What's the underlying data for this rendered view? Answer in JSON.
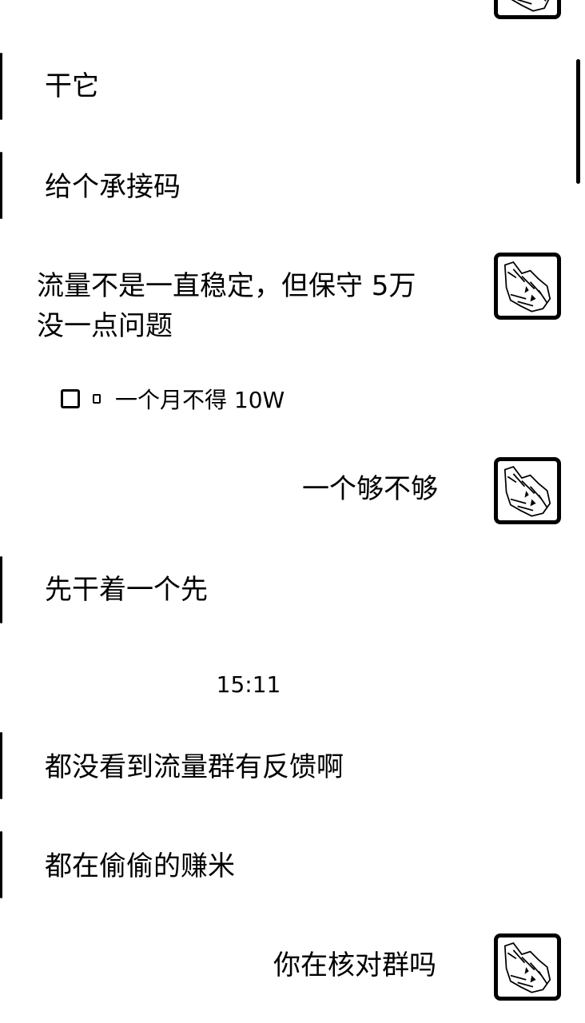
{
  "messages": [
    {
      "side": "left",
      "text": "干它"
    },
    {
      "side": "left",
      "text": "给个承接码"
    },
    {
      "side": "right",
      "text_line1": "流量不是一直稳定，但保守 5万",
      "text_line2": "没一点问题"
    },
    {
      "side": "quote",
      "text": "一个月不得 10W"
    },
    {
      "side": "right",
      "text": "一个够不够"
    },
    {
      "side": "left",
      "text": "先干着一个先"
    },
    {
      "side": "time",
      "text": "15:11"
    },
    {
      "side": "left",
      "text": "都没看到流量群有反馈啊"
    },
    {
      "side": "left",
      "text": "都在偷偷的赚米"
    },
    {
      "side": "right",
      "text": "你在核对群吗"
    }
  ],
  "icons": {
    "avatar": "wolf-sketch-avatar-icon",
    "quote_box": "checkbox-icon",
    "quote_marker": "small-document-icon"
  }
}
